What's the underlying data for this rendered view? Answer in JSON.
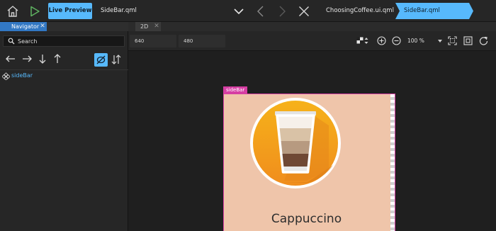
{
  "toolbar": {
    "live_preview_label": "Live Preview",
    "current_file": "SideBar.qml",
    "ui_file": "ChoosingCoffee.ui.qml",
    "active_file": "SideBar.qml",
    "accent_color": "#57b9fc"
  },
  "navigator": {
    "tab_label": "Navigator",
    "tab_close": "✕",
    "search_placeholder": "Search",
    "items": [
      {
        "label": "sideBar",
        "icon": "component-icon"
      }
    ]
  },
  "editor": {
    "tab_label": "2D",
    "tab_close": "✕",
    "width_value": "640",
    "height_value": "480",
    "zoom_value": "100 %"
  },
  "canvas": {
    "component_label": "sideBar",
    "component_color": "#d63ea3",
    "background_color": "#efc5aa",
    "item_name": "Cappuccino"
  }
}
